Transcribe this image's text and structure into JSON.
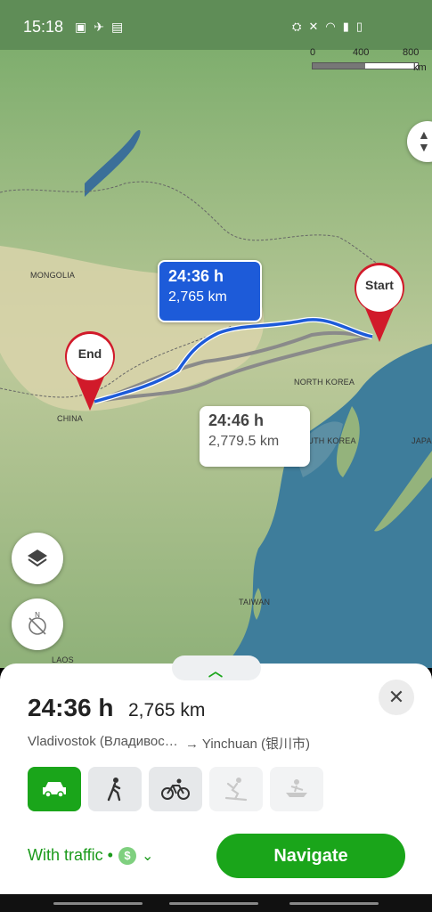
{
  "status_bar": {
    "time": "15:18",
    "left_icons": [
      "image-icon",
      "flight-mode-icon",
      "nfc-icon"
    ],
    "right_icons": [
      "battery-saver-icon",
      "mute-icon",
      "wifi-icon",
      "signal-icon",
      "battery-icon"
    ]
  },
  "map": {
    "scale": {
      "labels": [
        "0",
        "400",
        "800"
      ],
      "unit": "km"
    },
    "labels": {
      "mongolia": "MONGOLIA",
      "china": "CHINA",
      "north_korea": "NORTH KOREA",
      "south_korea": "SOUTH KOREA",
      "japan": "JAPA",
      "taiwan": "TAIWAN",
      "laos": "LAOS"
    },
    "pins": {
      "start": "Start",
      "end": "End"
    },
    "route_main": {
      "time": "24:36 h",
      "distance": "2,765 km"
    },
    "route_alt": {
      "time": "24:46 h",
      "distance": "2,779.5 km"
    },
    "colors": {
      "route_selected": "#1d5bd9",
      "route_alt": "#8a8a8a",
      "pin": "#d11a2a"
    }
  },
  "panel": {
    "handle_icon": "chevron-up-icon",
    "time": "24:36 h",
    "distance": "2,765 km",
    "from": "Vladivostok (Владивосток)",
    "to": "→ Yinchuan (银川市)",
    "modes": [
      {
        "name": "car",
        "icon": "car-icon",
        "state": "active"
      },
      {
        "name": "walk",
        "icon": "walk-icon",
        "state": "normal"
      },
      {
        "name": "bike",
        "icon": "bike-icon",
        "state": "normal"
      },
      {
        "name": "ski",
        "icon": "ski-icon",
        "state": "disabled"
      },
      {
        "name": "boat",
        "icon": "boat-icon",
        "state": "disabled"
      }
    ],
    "traffic_label": "With traffic •",
    "traffic_symbol": "$",
    "navigate_label": "Navigate",
    "accent_color": "#1aa51a"
  }
}
